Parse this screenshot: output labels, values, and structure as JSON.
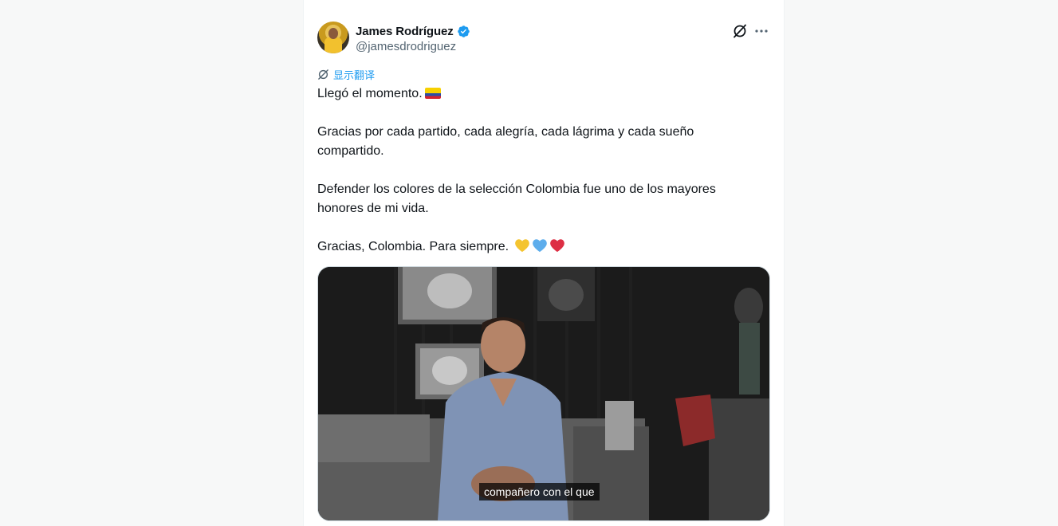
{
  "tweet": {
    "author": {
      "display_name": "James Rodríguez",
      "handle": "@jamesdrodriguez",
      "verified": true
    },
    "actions": {
      "grok_icon": "grok-icon",
      "more_icon": "more-horizontal-icon"
    },
    "translate_label": "显示翻译",
    "paragraphs": [
      "Llegó el momento.",
      "Gracias por cada partido, cada alegría, cada lágrima y cada sueño compartido.",
      "Defender los colores de la selección Colombia fue uno de los mayores honores de mi vida.",
      "Gracias, Colombia. Para siempre."
    ],
    "emojis": {
      "flag": "flag-colombia",
      "hearts": [
        "yellow-heart",
        "blue-heart",
        "red-heart"
      ]
    },
    "media": {
      "type": "video",
      "caption": "compañero con el que"
    }
  },
  "colors": {
    "accent": "#1d9bf0",
    "text_primary": "#0f1419",
    "text_secondary": "#536471",
    "heart_yellow": "#f4c42f",
    "heart_blue": "#5dadec",
    "heart_red": "#dd2e44"
  }
}
